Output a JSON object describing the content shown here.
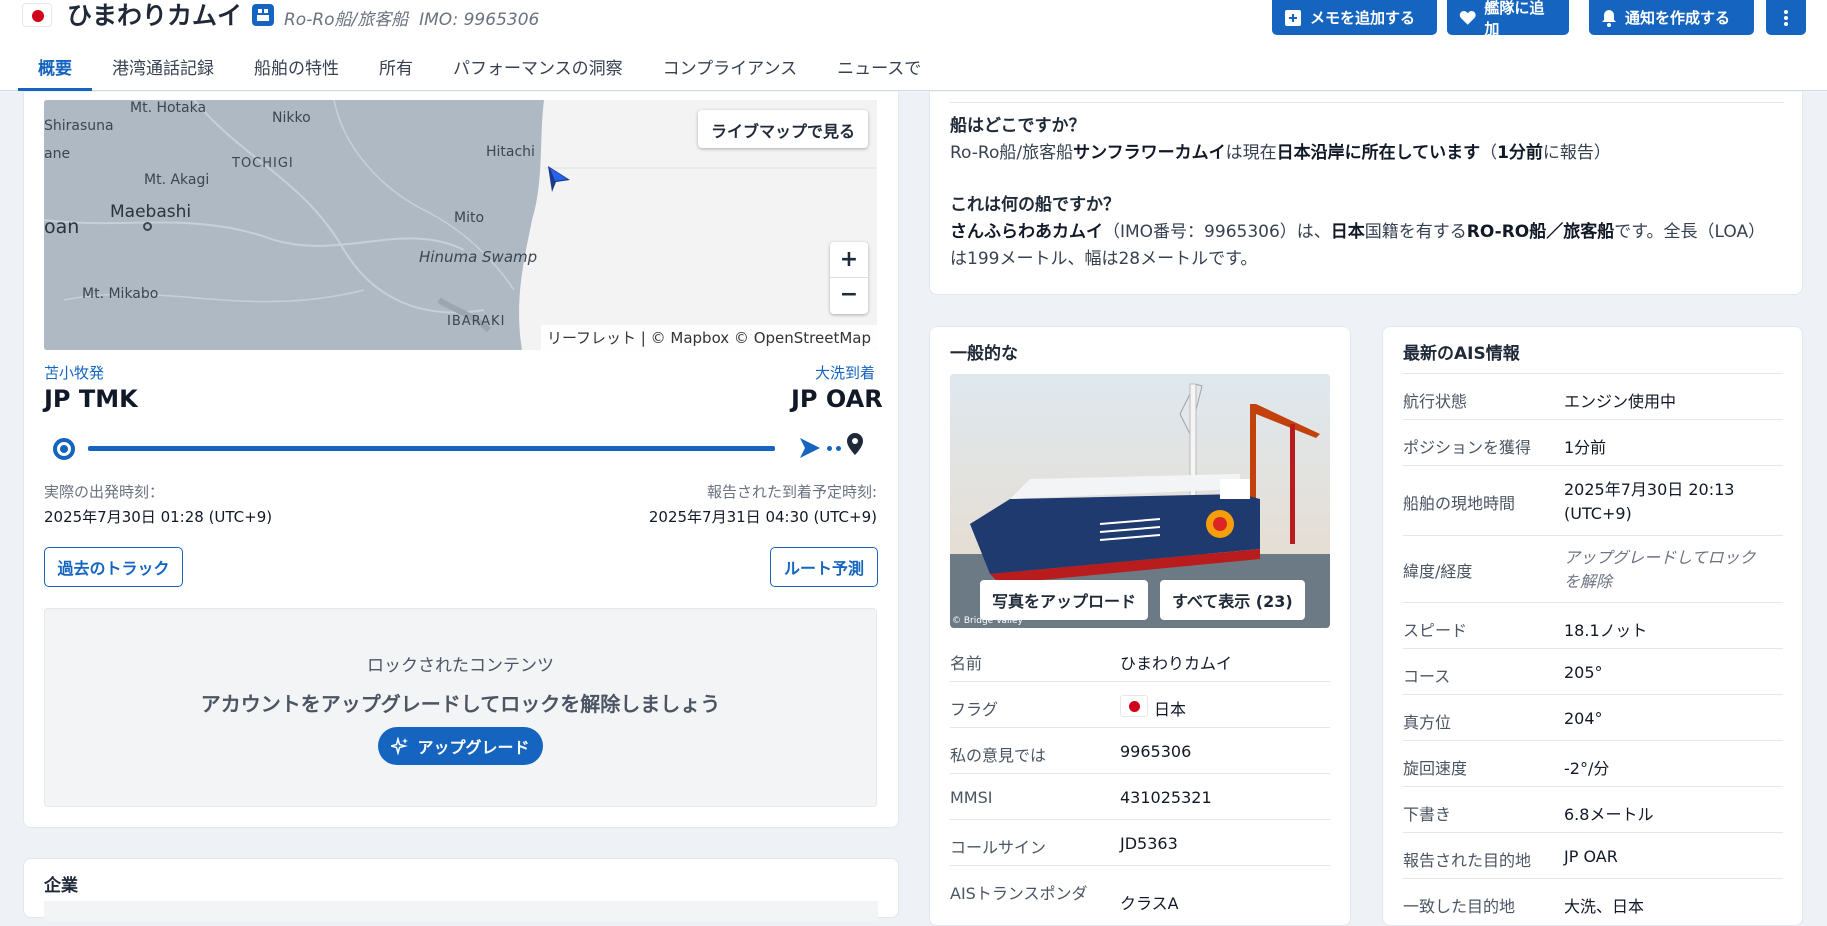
{
  "header": {
    "vessel_name": "ひまわりカムイ",
    "vessel_type": "Ro-Ro船/旅客船",
    "imo": "IMO: 9965306",
    "actions": [
      {
        "label": "メモを追加する",
        "icon": "note-plus-icon"
      },
      {
        "label": "艦隊に追加",
        "icon": "heart-icon"
      },
      {
        "label": "通知を作成する",
        "icon": "bell-icon"
      }
    ],
    "more_icon": "more-vertical-icon"
  },
  "tabs": [
    "概要",
    "港湾通話記録",
    "船舶の特性",
    "所有",
    "パフォーマンスの洞察",
    "コンプライアンス",
    "ニュースで"
  ],
  "map": {
    "live_map_button": "ライブマップで見る",
    "zoom_in": "+",
    "zoom_out": "−",
    "attribution": "リーフレット | © Mapbox © OpenStreetMap",
    "labels": [
      "Mt. Hotaka",
      "Shirasuna",
      "Nikko",
      "TOCHIGI",
      "Mt. Akagi",
      "Maebashi",
      "oan",
      "ane",
      "Hitachi",
      "Mito",
      "Hinuma Swamp",
      "Mt. Mikabo",
      "IBARAKI"
    ]
  },
  "voyage": {
    "departure_label": "苫小牧発",
    "arrival_label": "大洗到着",
    "departure_port": "JP TMK",
    "arrival_port": "JP OAR",
    "progress_fraction": 0.92,
    "actual_departure_label": "実際の出発時刻：",
    "actual_departure": "2025年7月30日 01:28 (UTC+9)",
    "eta_label": "報告された到着予定時刻:",
    "eta": "2025年7月31日 04:30 (UTC+9)",
    "past_track_button": "過去のトラック",
    "route_forecast_button": "ルート予測"
  },
  "locked": {
    "title": "ロックされたコンテンツ",
    "message": "アカウントをアップグレードしてロックを解除しましょう",
    "upgrade_button": "アップグレード"
  },
  "company_section_title": "企業",
  "summary": {
    "q1": "船はどこですか？",
    "a1_prefix": "Ro-Ro船/旅客船",
    "a1_name": "サンフラワーカムイ",
    "a1_mid": "は現在",
    "a1_location": "日本沿岸に所在しています",
    "a1_time_open": "（",
    "a1_time": "1分前",
    "a1_time_suffix": "に報告）",
    "q2": "これは何の船ですか？",
    "a2_name": "さんふらわあカムイ",
    "a2_imo": "（IMO番号：9965306）は、",
    "a2_flag": "日本",
    "a2_flag_suffix": "国籍を有する",
    "a2_type": "RO-RO船／旅客船",
    "a2_rest": "です。全長（LOA）",
    "a2_line2": "は199メートル、幅は28メートルです。"
  },
  "general": {
    "title": "一般的な",
    "upload_photo": "写真をアップロード",
    "show_all": "すべて表示 (23)",
    "photo_credit": "© Bridge Valley",
    "rows": [
      {
        "key": "名前",
        "value": "ひまわりカムイ"
      },
      {
        "key": "フラグ",
        "value": "日本"
      },
      {
        "key": "私の意見では",
        "value": "9965306"
      },
      {
        "key": "MMSI",
        "value": "431025321"
      },
      {
        "key": "コールサイン",
        "value": "JD5363"
      },
      {
        "key": "AISトランスポンダ",
        "value": "クラスA"
      }
    ]
  },
  "ais": {
    "title": "最新のAIS情報",
    "rows": [
      {
        "key": "航行状態",
        "value": "エンジン使用中"
      },
      {
        "key": "ポジションを獲得",
        "value": "1分前"
      },
      {
        "key": "船舶の現地時間",
        "value": "2025年7月30日 20:13",
        "value2": "(UTC+9)"
      },
      {
        "key": "緯度/経度",
        "value": "アップグレードしてロック",
        "value2": "を解除"
      },
      {
        "key": "スピード",
        "value": "18.1ノット"
      },
      {
        "key": "コース",
        "value": "205°"
      },
      {
        "key": "真方位",
        "value": "204°"
      },
      {
        "key": "旋回速度",
        "value": "-2°/分"
      },
      {
        "key": "下書き",
        "value": "6.8メートル"
      },
      {
        "key": "報告された目的地",
        "value": "JP OAR"
      },
      {
        "key": "一致した目的地",
        "value": "大洗、日本"
      }
    ]
  },
  "colors": {
    "accent": "#1565c0",
    "flag_red": "#d0011b"
  }
}
